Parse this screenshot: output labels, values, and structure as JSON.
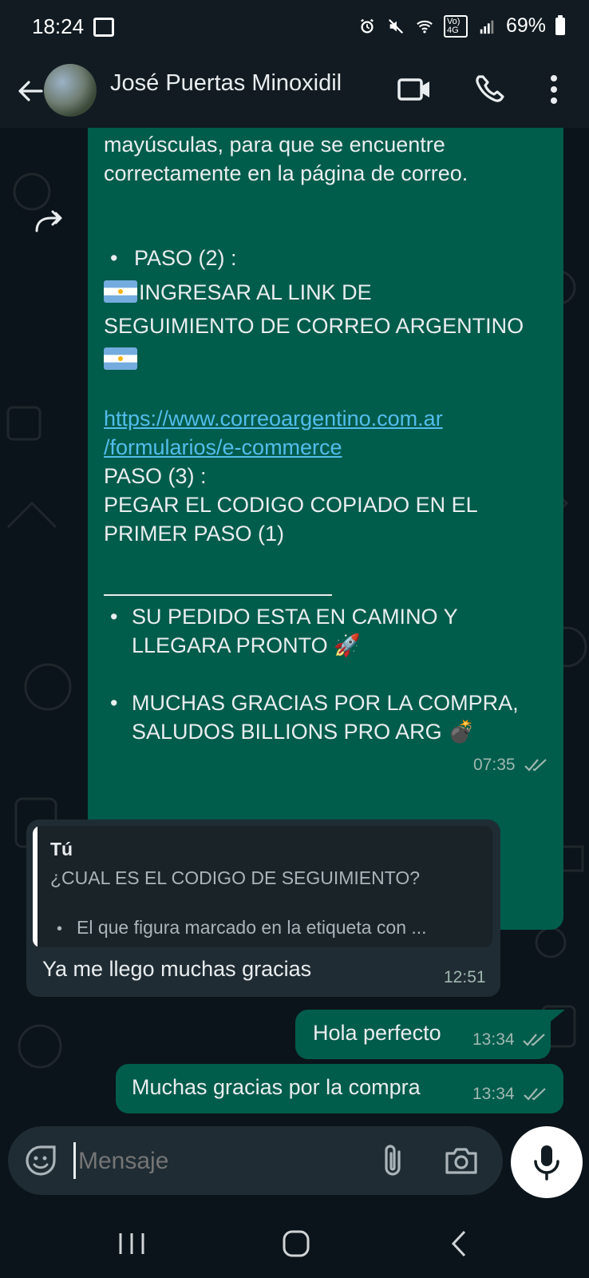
{
  "status_bar": {
    "time": "18:24",
    "signal_label": "Vo) 4G",
    "battery": "69%"
  },
  "header": {
    "contact_name": "José Puertas Minoxidil"
  },
  "messages": {
    "big": {
      "line1": "mayúsculas, para que se encuentre",
      "line2": "correctamente en la página de correo.",
      "paso2_bullet": "•",
      "paso2_label": "PASO (2) :",
      "ingresar": "INGRESAR AL LINK DE",
      "seguimiento": "SEGUIMIENTO DE CORREO ARGENTINO",
      "link1": "https://www.correoargentino.com.ar",
      "link2": "/formularios/e-commerce",
      "paso3": "PASO (3) :",
      "pegar1": "PEGAR EL CODIGO COPIADO EN EL",
      "pegar2": "PRIMER PASO (1)",
      "bullet_a": "•",
      "su_pedido1": "SU PEDIDO ESTA EN CAMINO Y",
      "su_pedido2": "LLEGARA PRONTO 🚀",
      "bullet_b": "•",
      "gracias1": "MUCHAS GRACIAS POR LA COMPRA,",
      "gracias2": "SALUDOS BILLIONS PRO ARG 💣",
      "time": "07:35"
    },
    "reply": {
      "quote_author": "Tú",
      "quote_line1": "¿CUAL ES EL CODIGO DE SEGUIMIENTO?",
      "quote_bullet": "•",
      "quote_line2": "El que figura marcado en la etiqueta con ...",
      "text": "Ya me llego muchas gracias",
      "time": "12:51"
    },
    "out1": {
      "text": "Hola perfecto",
      "time": "13:34"
    },
    "out2": {
      "text": "Muchas gracias por la compra",
      "time": "13:34"
    }
  },
  "composer": {
    "placeholder": "Mensaje"
  },
  "colors": {
    "outgoing_bubble": "#005c4b",
    "incoming_bubble": "#202c33",
    "link": "#53bdeb",
    "read_ticks": "#9fb8b1"
  }
}
